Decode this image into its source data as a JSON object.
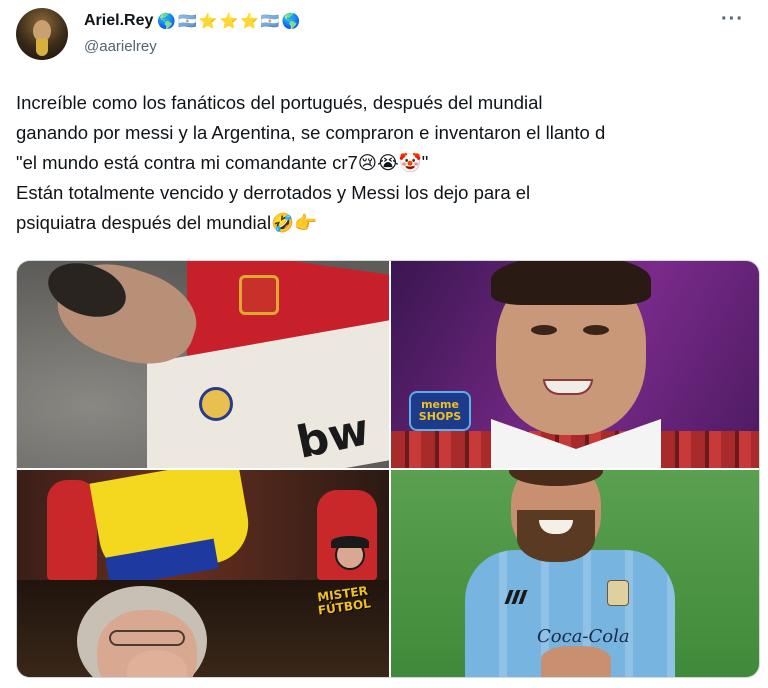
{
  "author": {
    "name": "Ariel.Rey",
    "handle": "@aarielrey",
    "badges": [
      "🌎",
      "🇦🇷",
      "⭐",
      "⭐",
      "⭐",
      "🇦🇷",
      "🌎"
    ]
  },
  "more_label": "···",
  "tweet": {
    "lines": [
      "Increíble como los fanáticos del portugués, después del mundial",
      "ganando por messi y la Argentina, se compraron e inventaron el llanto d",
      "\"el mundo está contra mi comandante cr7😢😭🤡\"",
      "Están totalmente vencido y derrotados y Messi los dejo para el",
      "psiquiatra después del mundial🤣👉"
    ]
  },
  "media": {
    "image1": {
      "sponsor": "bw"
    },
    "image2": {
      "badge_line1": "meme",
      "badge_line2": "SHOPS"
    },
    "image3": {
      "watermark_line1": "MISTER",
      "watermark_line2": "FÚTBOL"
    },
    "image4": {
      "sponsor": "Coca-Cola"
    }
  }
}
